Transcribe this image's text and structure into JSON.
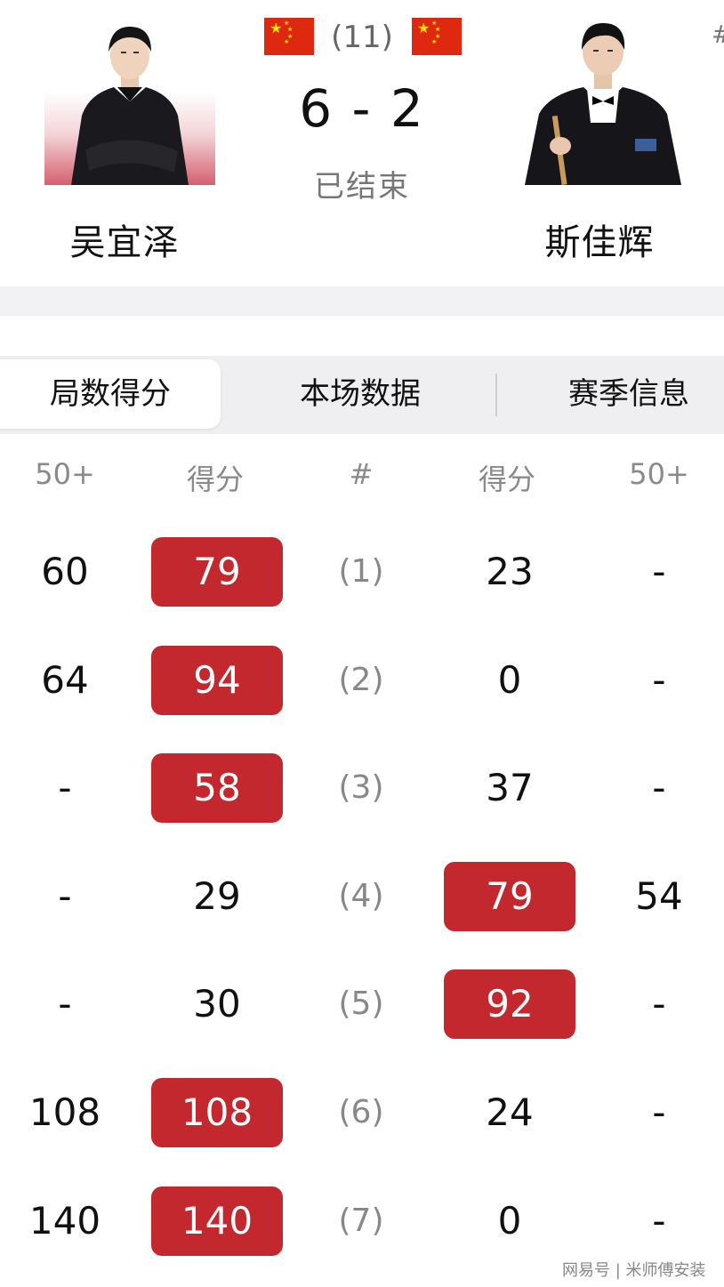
{
  "match": {
    "player_left": "吴宜泽",
    "player_right": "斯佳辉",
    "round": "(11)",
    "score": "6 - 2",
    "status": "已结束",
    "corner_mark": "#"
  },
  "tabs": [
    {
      "label": "局数得分",
      "active": true
    },
    {
      "label": "本场数据",
      "active": false
    },
    {
      "label": "赛季信息",
      "active": false
    }
  ],
  "columns": [
    "50+",
    "得分",
    "#",
    "得分",
    "50+"
  ],
  "frames": [
    {
      "left_50": "60",
      "left_score": "79",
      "frame": "(1)",
      "right_score": "23",
      "right_50": "-",
      "winner": "left"
    },
    {
      "left_50": "64",
      "left_score": "94",
      "frame": "(2)",
      "right_score": "0",
      "right_50": "-",
      "winner": "left"
    },
    {
      "left_50": "-",
      "left_score": "58",
      "frame": "(3)",
      "right_score": "37",
      "right_50": "-",
      "winner": "left"
    },
    {
      "left_50": "-",
      "left_score": "29",
      "frame": "(4)",
      "right_score": "79",
      "right_50": "54",
      "winner": "right"
    },
    {
      "left_50": "-",
      "left_score": "30",
      "frame": "(5)",
      "right_score": "92",
      "right_50": "-",
      "winner": "right"
    },
    {
      "left_50": "108",
      "left_score": "108",
      "frame": "(6)",
      "right_score": "24",
      "right_50": "-",
      "winner": "left"
    },
    {
      "left_50": "140",
      "left_score": "140",
      "frame": "(7)",
      "right_score": "0",
      "right_50": "-",
      "winner": "left"
    }
  ],
  "colors": {
    "win_pill": "#c3282f",
    "tab_bg": "#efeff1",
    "flag_red": "#de2910",
    "flag_star": "#ffde00"
  },
  "icons": {
    "flag_left": "china-flag-icon",
    "flag_right": "china-flag-icon"
  },
  "watermark": "网易号 | 米师傅安装"
}
